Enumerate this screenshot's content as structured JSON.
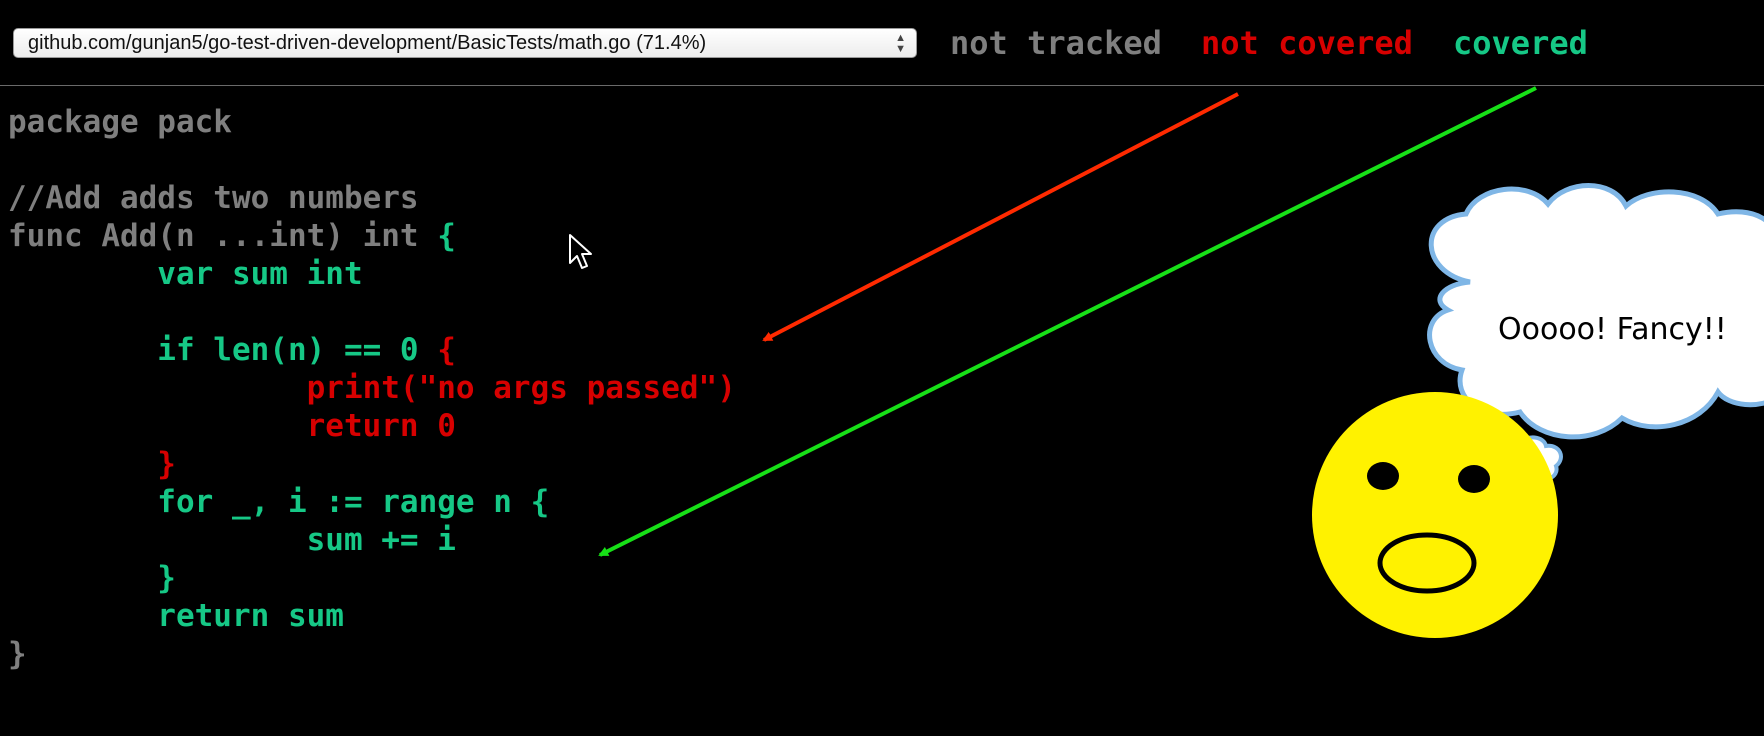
{
  "toolbar": {
    "file_select_value": "github.com/gunjan5/go-test-driven-development/BasicTests/math.go (71.4%)",
    "legend": {
      "not_tracked": "not tracked",
      "not_covered": "not covered",
      "covered": "covered"
    }
  },
  "colors": {
    "not_tracked": "#7f7f7f",
    "not_covered": "#d70000",
    "covered": "#16c886",
    "arrow_red": "#ff2a00",
    "arrow_green": "#17e017",
    "smiley": "#fff200",
    "cloud_border": "#7fb6e6"
  },
  "code": [
    {
      "text": "package pack",
      "status": "not_tracked"
    },
    {
      "text": "",
      "status": "not_tracked"
    },
    {
      "text": "//Add adds two numbers",
      "status": "not_tracked"
    },
    {
      "segments": [
        {
          "text": "func Add(n ...int) int ",
          "status": "not_tracked"
        },
        {
          "text": "{",
          "status": "covered"
        }
      ]
    },
    {
      "text": "\tvar sum int",
      "status": "covered"
    },
    {
      "text": "",
      "status": "not_tracked"
    },
    {
      "segments": [
        {
          "text": "\tif len(n) == 0 ",
          "status": "covered"
        },
        {
          "text": "{",
          "status": "not_covered"
        }
      ]
    },
    {
      "text": "\t\tprint(\"no args passed\")",
      "status": "not_covered"
    },
    {
      "text": "\t\treturn 0",
      "status": "not_covered"
    },
    {
      "text": "\t}",
      "status": "not_covered"
    },
    {
      "text": "\tfor _, i := range n {",
      "status": "covered"
    },
    {
      "text": "\t\tsum += i",
      "status": "covered"
    },
    {
      "text": "\t}",
      "status": "covered"
    },
    {
      "text": "\treturn sum",
      "status": "covered"
    },
    {
      "text": "}",
      "status": "not_tracked"
    }
  ],
  "annotation": {
    "thought_text": "Ooooo! Fancy!!"
  },
  "icons": {
    "cursor": "mouse-pointer-icon",
    "select_arrows": "up-down-arrows-icon"
  }
}
